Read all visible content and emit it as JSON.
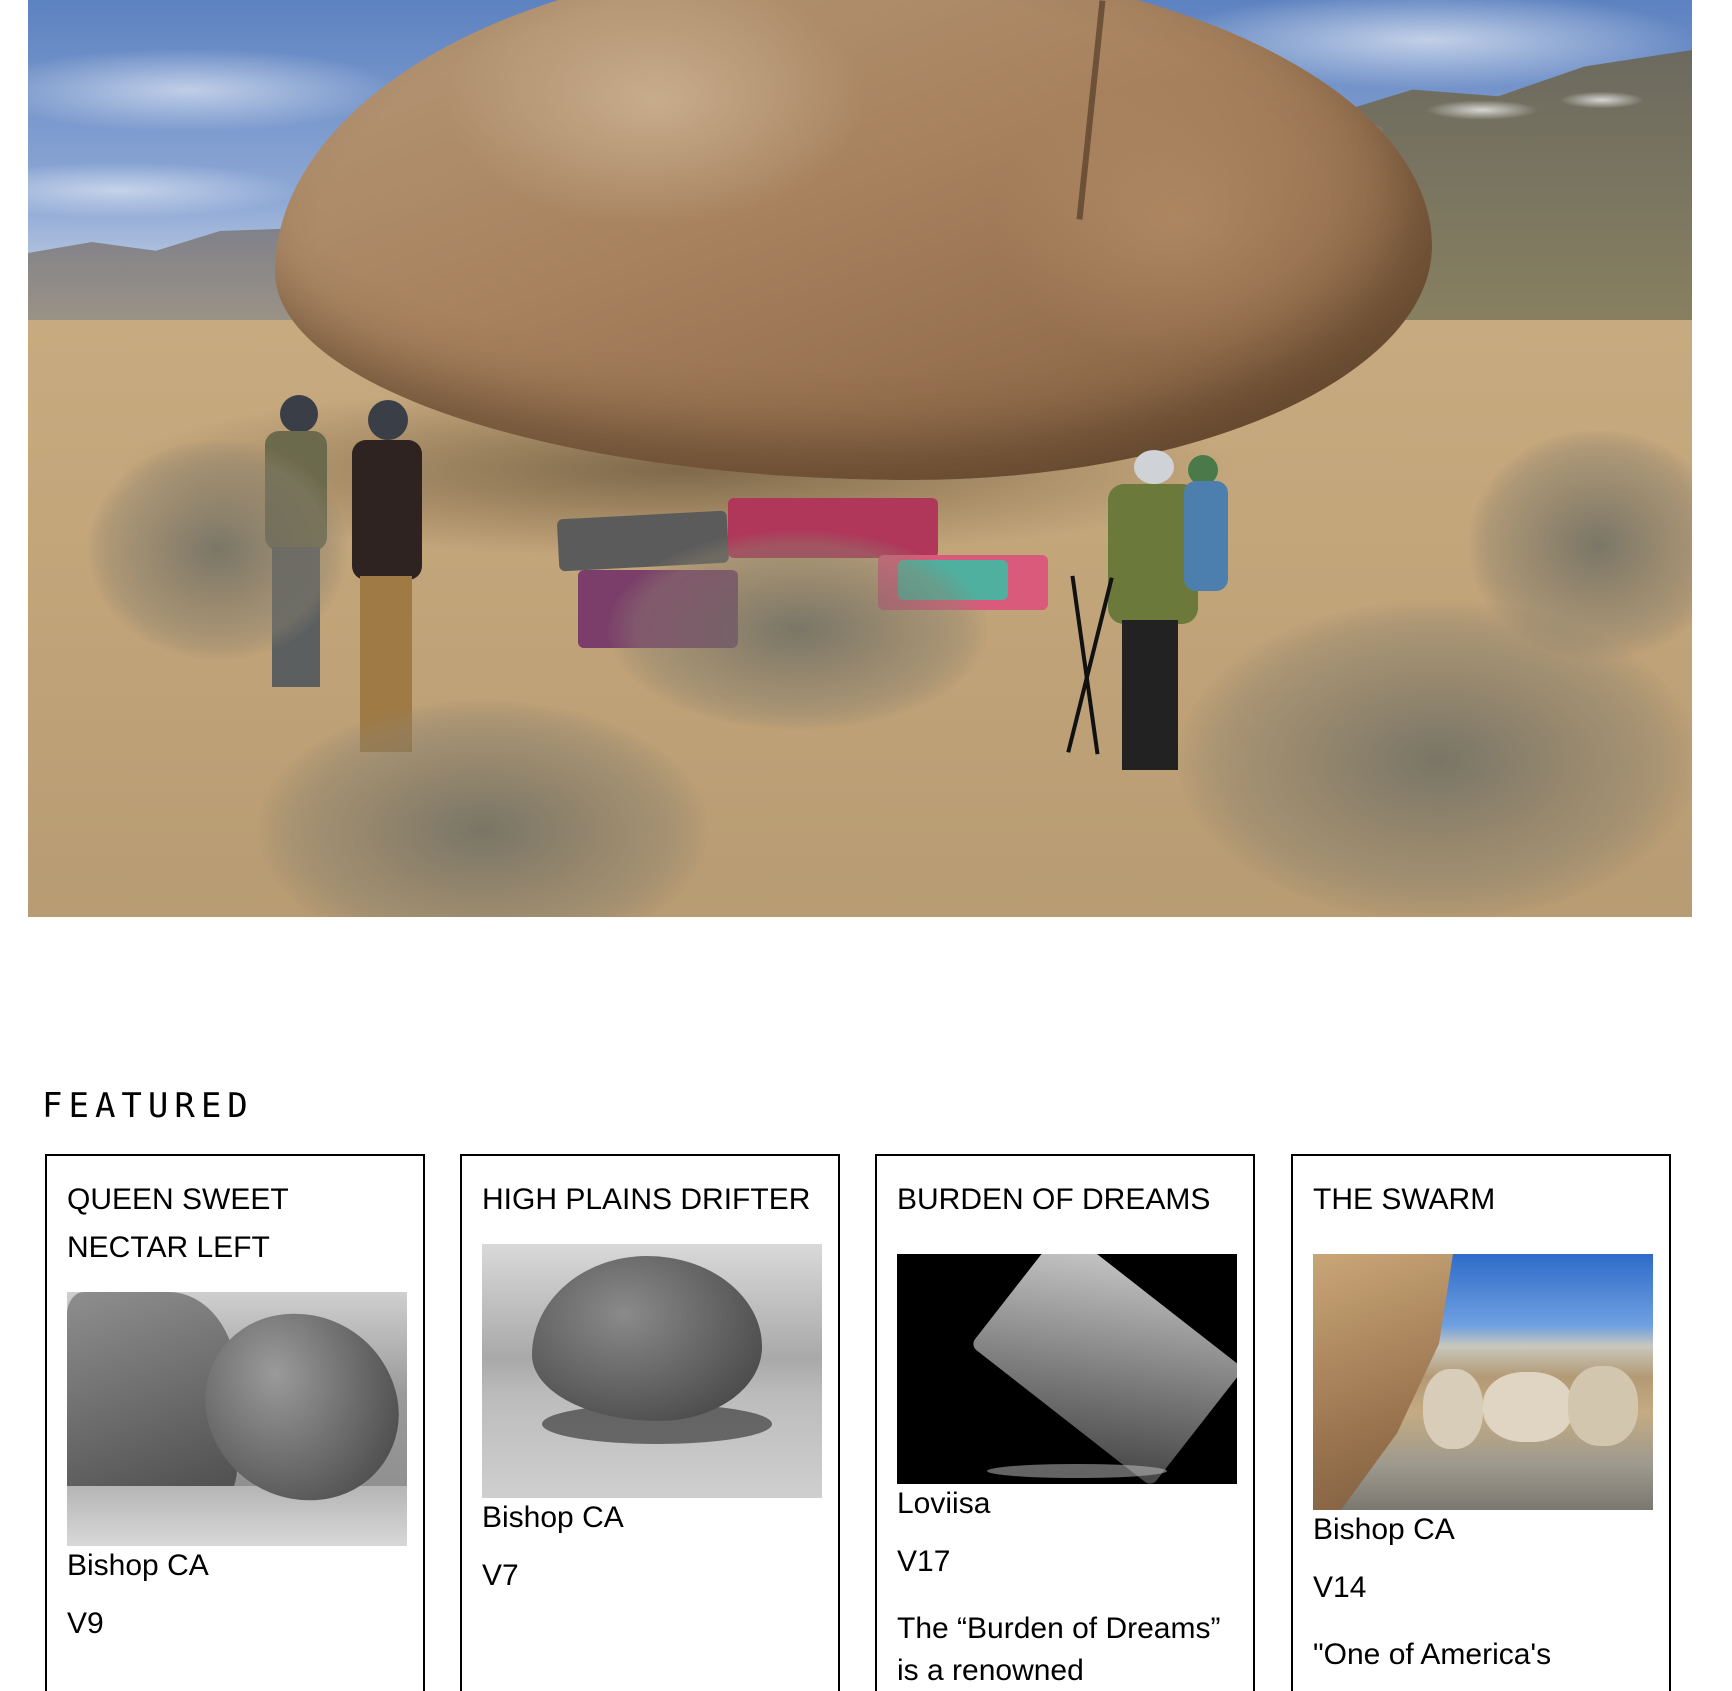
{
  "hero": {},
  "featured": {
    "heading": "FEATURED",
    "cards": [
      {
        "title": "QUEEN SWEET NECTAR LEFT",
        "location": "Bishop CA",
        "grade": "V9"
      },
      {
        "title": "HIGH PLAINS DRIFTER",
        "location": "Bishop CA",
        "grade": "V7"
      },
      {
        "title": "BURDEN OF DREAMS",
        "location": "Loviisa",
        "grade": "V17",
        "description": "The “Burden of Dreams” is a renowned"
      },
      {
        "title": "THE SWARM",
        "location": "Bishop CA",
        "grade": "V14",
        "description": "\"One of America's"
      }
    ]
  }
}
